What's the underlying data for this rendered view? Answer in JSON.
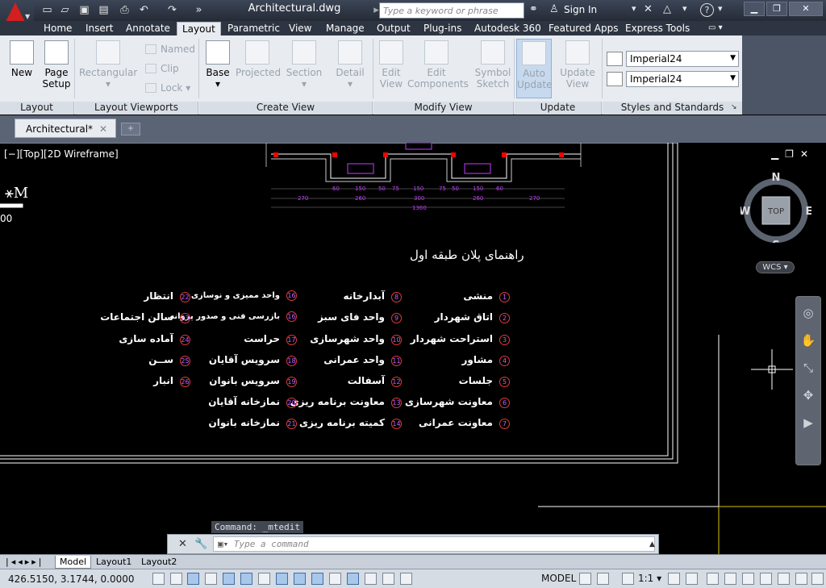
{
  "title_bar": {
    "document_title": "Architectural.dwg",
    "search_placeholder": "Type a keyword or phrase",
    "sign_in": "Sign In"
  },
  "ribbon_tabs": [
    "Home",
    "Insert",
    "Annotate",
    "Layout",
    "Parametric",
    "View",
    "Manage",
    "Output",
    "Plug-ins",
    "Autodesk 360",
    "Featured Apps",
    "Express Tools"
  ],
  "active_tab": "Layout",
  "ribbon": {
    "layout_panel": {
      "title": "Layout",
      "new": "New",
      "page_setup_1": "Page",
      "page_setup_2": "Setup"
    },
    "layout_viewports_panel": {
      "title": "Layout Viewports",
      "rectangular": "Rectangular",
      "named": "Named",
      "clip": "Clip",
      "lock": "Lock"
    },
    "create_view_panel": {
      "title": "Create View",
      "base": "Base",
      "projected": "Projected",
      "section": "Section",
      "detail": "Detail"
    },
    "modify_view_panel": {
      "title": "Modify View",
      "edit_view_1": "Edit",
      "edit_view_2": "View",
      "edit_components_1": "Edit",
      "edit_components_2": "Components",
      "symbol_sketch_1": "Symbol",
      "symbol_sketch_2": "Sketch"
    },
    "update_panel": {
      "title": "Update",
      "auto_update_1": "Auto",
      "auto_update_2": "Update",
      "update_view_1": "Update",
      "update_view_2": "View"
    },
    "styles_panel": {
      "title": "Styles and Standards",
      "style_1": "Imperial24",
      "style_2": "Imperial24"
    }
  },
  "document_tab": "Architectural*",
  "viewport": {
    "label": "[−][Top][2D Wireframe]",
    "legend_title": "راهنمای پلان طبقه اول",
    "legend_items": [
      {
        "n": "1",
        "t": "منشی"
      },
      {
        "n": "2",
        "t": "اتاق شهردار"
      },
      {
        "n": "3",
        "t": "استراحت شهردار"
      },
      {
        "n": "4",
        "t": "مشاور"
      },
      {
        "n": "5",
        "t": "جلسات"
      },
      {
        "n": "6",
        "t": "معاونت شهرسازی"
      },
      {
        "n": "7",
        "t": "معاونت عمرانی"
      },
      {
        "n": "8",
        "t": "آبدارخانه"
      },
      {
        "n": "9",
        "t": "واحد فای سبز"
      },
      {
        "n": "10",
        "t": "واحد شهرسازی"
      },
      {
        "n": "11",
        "t": "واحد عمرانی"
      },
      {
        "n": "12",
        "t": "آسفالت"
      },
      {
        "n": "13",
        "t": "معاونت برنامه ریزی"
      },
      {
        "n": "14",
        "t": "کمیته برنامه ریزی"
      },
      {
        "n": "16",
        "t": "واحد ممیزی و نوسازی"
      },
      {
        "n": "16",
        "t": "بازرسی فنی و صدور پروانه"
      },
      {
        "n": "17",
        "t": "حراست"
      },
      {
        "n": "18",
        "t": "سرویس آقایان"
      },
      {
        "n": "19",
        "t": "سرویس بانوان"
      },
      {
        "n": "20",
        "t": "نمازخانه آقایان"
      },
      {
        "n": "21",
        "t": "نمازخانه بانوان"
      },
      {
        "n": "22",
        "t": "انتظار"
      },
      {
        "n": "23",
        "t": "سالن اجتماعات"
      },
      {
        "n": "24",
        "t": "آماده سازی"
      },
      {
        "n": "25",
        "t": "ســن"
      },
      {
        "n": "26",
        "t": "انبار"
      }
    ],
    "dims_top": [
      "60",
      "150",
      "50",
      "75",
      "150",
      "75",
      "50",
      "150",
      "60"
    ],
    "dims_mid": [
      "270",
      "260",
      "300",
      "260",
      "270"
    ],
    "dim_total": "1360",
    "compass": {
      "n": "N",
      "s": "S",
      "e": "E",
      "w": "W",
      "center": "TOP",
      "wcs": "WCS"
    }
  },
  "command": {
    "last": "Command: _mtedit",
    "placeholder": "Type a command"
  },
  "layout_tabs": [
    "Model",
    "Layout1",
    "Layout2"
  ],
  "status": {
    "coords": "426.5150, 3.1744, 0.0000",
    "model": "MODEL",
    "scale": "1:1"
  }
}
